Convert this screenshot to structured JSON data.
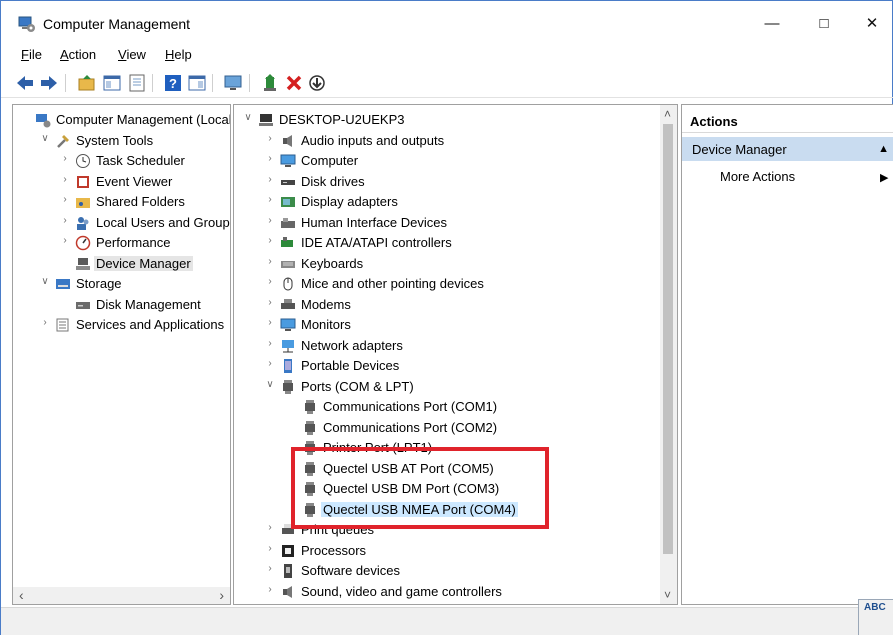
{
  "window": {
    "title": "Computer Management",
    "minimize_glyph": "—",
    "maximize_glyph": "□",
    "close_glyph": "✕"
  },
  "menu": [
    {
      "key": "F",
      "rest": "ile"
    },
    {
      "key": "A",
      "rest": "ction"
    },
    {
      "key": "V",
      "rest": "iew"
    },
    {
      "key": "H",
      "rest": "elp"
    }
  ],
  "toolbar": [
    "back-arrow-icon",
    "forward-arrow-icon",
    "up-folder-icon",
    "show-hide-tree-icon",
    "properties-icon",
    "help-icon",
    "console-pane-icon",
    "monitor-icon",
    "update-driver-icon",
    "uninstall-icon",
    "download-icon"
  ],
  "left_tree": [
    {
      "label": "Computer Management (Local",
      "expander": "",
      "icon": "computer-management-icon",
      "level": 0
    },
    {
      "label": "System Tools",
      "expander": "∨",
      "icon": "tools-icon",
      "level": 1
    },
    {
      "label": "Task Scheduler",
      "expander": "›",
      "icon": "clock-icon",
      "level": 2
    },
    {
      "label": "Event Viewer",
      "expander": "›",
      "icon": "event-viewer-icon",
      "level": 2
    },
    {
      "label": "Shared Folders",
      "expander": "›",
      "icon": "shared-folder-icon",
      "level": 2
    },
    {
      "label": "Local Users and Groups",
      "expander": "›",
      "icon": "users-icon",
      "level": 2
    },
    {
      "label": "Performance",
      "expander": "›",
      "icon": "performance-icon",
      "level": 2
    },
    {
      "label": "Device Manager",
      "expander": "",
      "icon": "device-manager-icon",
      "level": 2,
      "selected": true
    },
    {
      "label": "Storage",
      "expander": "∨",
      "icon": "storage-icon",
      "level": 1
    },
    {
      "label": "Disk Management",
      "expander": "",
      "icon": "disk-icon",
      "level": 2
    },
    {
      "label": "Services and Applications",
      "expander": "›",
      "icon": "services-icon",
      "level": 1
    }
  ],
  "device_tree": [
    {
      "label": "DESKTOP-U2UEKP3",
      "expander": "∨",
      "icon": "computer-icon",
      "level": 0
    },
    {
      "label": "Audio inputs and outputs",
      "expander": "›",
      "icon": "speaker-icon",
      "level": 1
    },
    {
      "label": "Computer",
      "expander": "›",
      "icon": "monitor-icon",
      "level": 1
    },
    {
      "label": "Disk drives",
      "expander": "›",
      "icon": "disk-drive-icon",
      "level": 1
    },
    {
      "label": "Display adapters",
      "expander": "›",
      "icon": "display-adapter-icon",
      "level": 1
    },
    {
      "label": "Human Interface Devices",
      "expander": "›",
      "icon": "hid-icon",
      "level": 1
    },
    {
      "label": "IDE ATA/ATAPI controllers",
      "expander": "›",
      "icon": "ide-controller-icon",
      "level": 1
    },
    {
      "label": "Keyboards",
      "expander": "›",
      "icon": "keyboard-icon",
      "level": 1
    },
    {
      "label": "Mice and other pointing devices",
      "expander": "›",
      "icon": "mouse-icon",
      "level": 1
    },
    {
      "label": "Modems",
      "expander": "›",
      "icon": "modem-icon",
      "level": 1
    },
    {
      "label": "Monitors",
      "expander": "›",
      "icon": "monitor-icon",
      "level": 1
    },
    {
      "label": "Network adapters",
      "expander": "›",
      "icon": "network-icon",
      "level": 1
    },
    {
      "label": "Portable Devices",
      "expander": "›",
      "icon": "portable-device-icon",
      "level": 1
    },
    {
      "label": "Ports (COM & LPT)",
      "expander": "∨",
      "icon": "port-icon",
      "level": 1
    },
    {
      "label": "Communications Port (COM1)",
      "expander": "",
      "icon": "port-icon",
      "level": 2
    },
    {
      "label": "Communications Port (COM2)",
      "expander": "",
      "icon": "port-icon",
      "level": 2
    },
    {
      "label": "Printer Port (LPT1)",
      "expander": "",
      "icon": "port-icon",
      "level": 2
    },
    {
      "label": "Quectel USB AT Port (COM5)",
      "expander": "",
      "icon": "port-icon",
      "level": 2
    },
    {
      "label": "Quectel USB DM Port (COM3)",
      "expander": "",
      "icon": "port-icon",
      "level": 2
    },
    {
      "label": "Quectel USB NMEA Port (COM4)",
      "expander": "",
      "icon": "port-icon",
      "level": 2,
      "selected": true
    },
    {
      "label": "Print queues",
      "expander": "›",
      "icon": "printer-icon",
      "level": 1
    },
    {
      "label": "Processors",
      "expander": "›",
      "icon": "processor-icon",
      "level": 1
    },
    {
      "label": "Software devices",
      "expander": "›",
      "icon": "software-device-icon",
      "level": 1
    },
    {
      "label": "Sound, video and game controllers",
      "expander": "›",
      "icon": "speaker-icon",
      "level": 1
    }
  ],
  "scrollbars": {
    "left_arrow": "‹",
    "right_arrow": "›",
    "up_arrow": "˄",
    "down_arrow": "˅"
  },
  "actions": {
    "header": "Actions",
    "section": "Device Manager",
    "section_glyph": "▲",
    "more": "More Actions",
    "more_glyph": "▶"
  },
  "colors": {
    "callout": "#e0232b",
    "selection": "#cce8ff",
    "section_bg": "#c9dcf0"
  },
  "corner_badge": "ABC"
}
